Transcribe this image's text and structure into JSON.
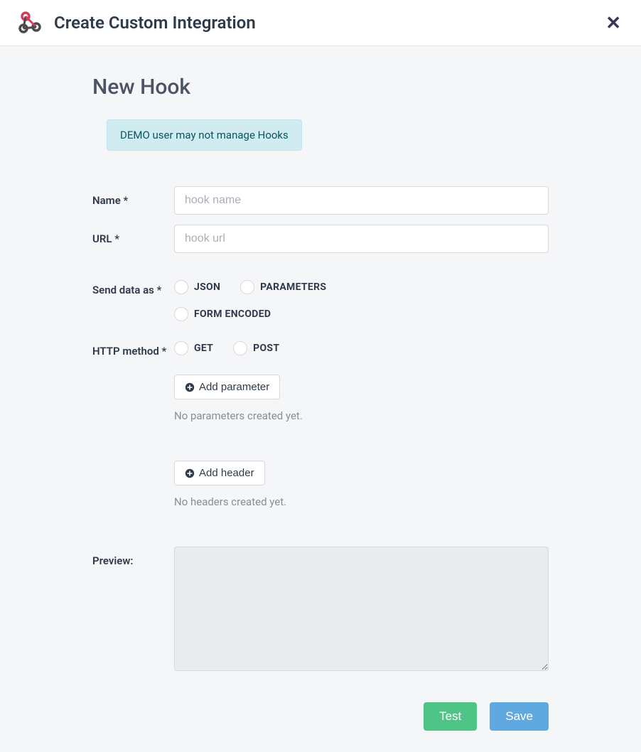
{
  "header": {
    "title": "Create Custom Integration"
  },
  "page": {
    "title": "New Hook",
    "alert": "DEMO user may not manage Hooks"
  },
  "form": {
    "name": {
      "label": "Name *",
      "placeholder": "hook name",
      "value": ""
    },
    "url": {
      "label": "URL *",
      "placeholder": "hook url",
      "value": ""
    },
    "send_data": {
      "label": "Send data as *",
      "options": {
        "json": "JSON",
        "parameters": "PARAMETERS",
        "form_encoded": "FORM ENCODED"
      }
    },
    "http_method": {
      "label": "HTTP method *",
      "options": {
        "get": "GET",
        "post": "POST"
      }
    },
    "parameters": {
      "add_label": "Add parameter",
      "empty_text": "No parameters created yet."
    },
    "headers": {
      "add_label": "Add header",
      "empty_text": "No headers created yet."
    },
    "preview": {
      "label": "Preview:",
      "value": ""
    }
  },
  "footer": {
    "test_label": "Test",
    "save_label": "Save"
  }
}
